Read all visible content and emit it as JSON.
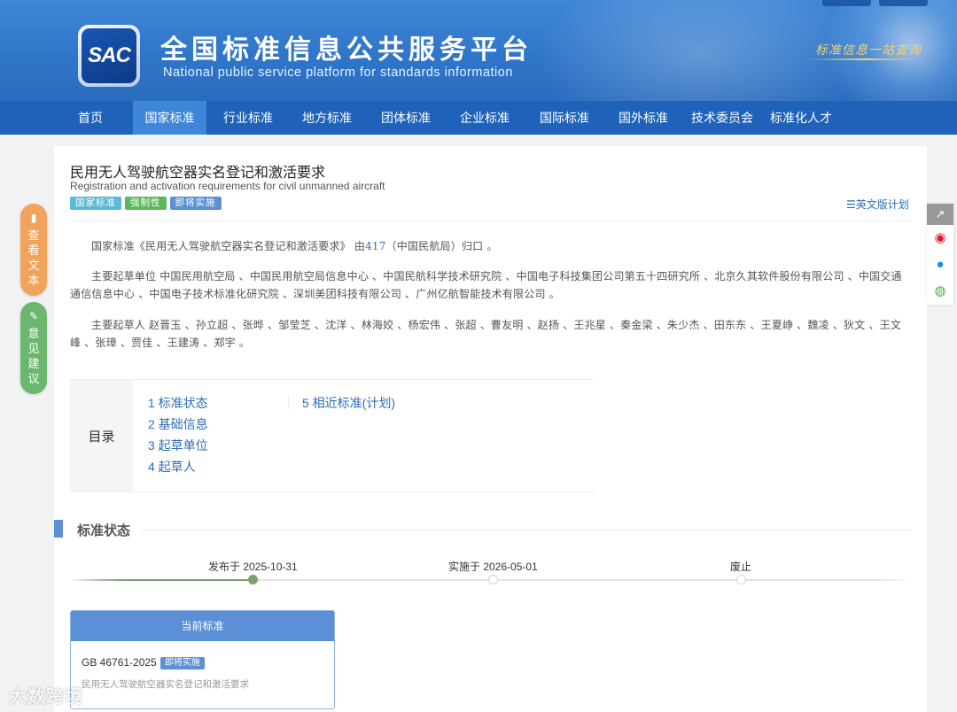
{
  "header": {
    "logo_text": "SAC",
    "title": "全国标准信息公共服务平台",
    "subtitle": "National public service platform  for standards information",
    "slogan": "标准信息一站查询"
  },
  "nav": {
    "items": [
      "首页",
      "国家标准",
      "行业标准",
      "地方标准",
      "团体标准",
      "企业标准",
      "国际标准",
      "国外标准",
      "技术委员会",
      "标准化人才"
    ],
    "active_index": 1
  },
  "standard": {
    "title": "民用无人驾驶航空器实名登记和激活要求",
    "title_en": "Registration and activation requirements for civil unmanned aircraft",
    "tags": [
      "国家标准",
      "强制性",
      "即将实施"
    ],
    "english_plan_label": "英文版计划",
    "intro_prefix": "国家标准《民用无人驾驶航空器实名登记和激活要求》 由",
    "intro_link": "417",
    "intro_suffix": "（中国民航局）归口 。",
    "drafting_units": "主要起草单位 中国民用航空局 、中国民用航空局信息中心 、中国民航科学技术研究院 、中国电子科技集团公司第五十四研究所 、北京久其软件股份有限公司 、中国交通通信信息中心 、中国电子技术标准化研究院 、深圳美团科技有限公司 、广州亿航智能技术有限公司 。",
    "drafters": "主要起草人 赵晋玉 、孙立超 、张晔 、邹莹芝 、沈洋 、林海姣 、杨宏伟 、张超 、曹友明 、赵扬 、王兆星 、秦金梁 、朱少杰 、田东东 、王夏峥 、魏凌 、狄文 、王文峰 、张璋 、贾佳 、王建涛 、郑宇 。"
  },
  "toc": {
    "label": "目录",
    "items": [
      "1  标准状态",
      "2  基础信息",
      "3  起草单位",
      "4  起草人",
      "5  相近标准(计划)"
    ]
  },
  "status_section": {
    "title": "标准状态",
    "timeline": [
      {
        "label": "发布于 2025-10-31",
        "done": true
      },
      {
        "label": "实施于 2026-05-01",
        "done": false
      },
      {
        "label": "废止",
        "done": false
      }
    ],
    "current": {
      "header": "当前标准",
      "code": "GB 46761-2025",
      "tag": "即将实施",
      "name": "民用无人驾驶航空器实名登记和激活要求"
    }
  },
  "left_buttons": {
    "view_text": [
      "查",
      "看",
      "文",
      "本"
    ],
    "feedback": [
      "意",
      "见",
      "建",
      "议"
    ]
  },
  "watermark": "大数跨境",
  "colors": {
    "header_blue": "#2f76c9",
    "nav_blue": "#1e63b9",
    "nav_active": "#3d86d8",
    "link_blue": "#2d6db5",
    "tag_national": "#5bb8d6",
    "tag_mandatory": "#5cb85c",
    "tag_upcoming": "#5b8fd6",
    "timeline_done": "#7ca06e"
  }
}
